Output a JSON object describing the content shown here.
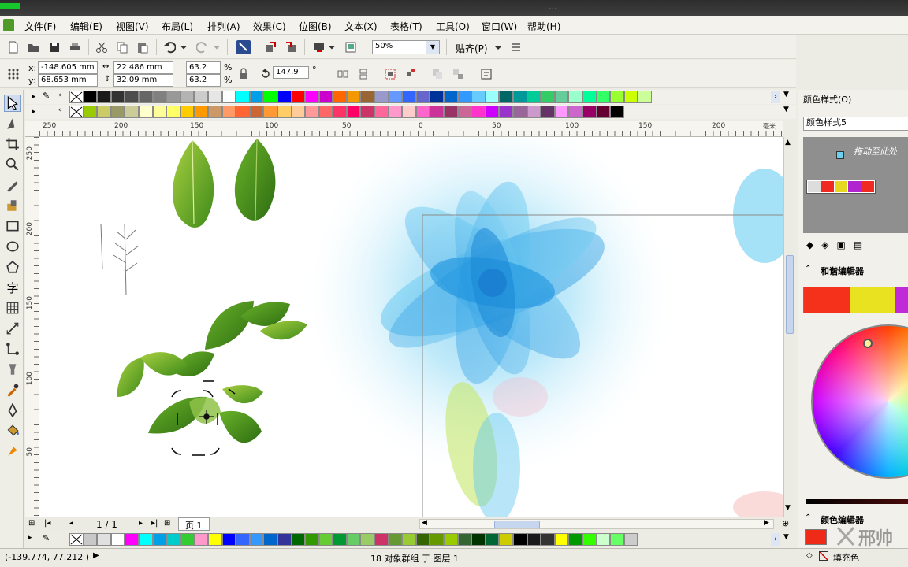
{
  "window": {
    "title": "..."
  },
  "menu": [
    "文件(F)",
    "编辑(E)",
    "视图(V)",
    "布局(L)",
    "排列(A)",
    "效果(C)",
    "位图(B)",
    "文本(X)",
    "表格(T)",
    "工具(O)",
    "窗口(W)",
    "帮助(H)"
  ],
  "toolbar": {
    "zoom": "50%",
    "snap": "贴齐(P)"
  },
  "property_bar": {
    "x": "-148.605 mm",
    "y": "68.653 mm",
    "x_label": "x:",
    "y_label": "y:",
    "width": "22.486 mm",
    "height": "32.09 mm",
    "scale_x": "63.2",
    "scale_y": "63.2",
    "pct1": "%",
    "pct2": "%",
    "rotation": "147.9",
    "deg": "°"
  },
  "rulers": {
    "h": [
      "250",
      "200",
      "150",
      "100",
      "50",
      "0",
      "50",
      "100",
      "150",
      "200"
    ],
    "v": [
      "250",
      "200",
      "150",
      "100",
      "50"
    ],
    "unit": "毫米"
  },
  "page_nav": {
    "count": "1 / 1",
    "tab": "页 1"
  },
  "status": {
    "coords": "(-139.774, 77.212 )",
    "selection": "18 对象群组 于 图层 1"
  },
  "docker": {
    "title": "颜色样式(O)",
    "style_name": "颜色样式5",
    "drop_hint": "拖动至此处",
    "harmony_editor": "和谐编辑器",
    "color_editor": "颜色编辑器",
    "fill_label": "填充色"
  },
  "watermark": {
    "text": "邢帅"
  },
  "colors": {
    "accent": "#316ac5",
    "harmony": [
      "#f5311b",
      "#e8e220",
      "#c02ad8"
    ],
    "color_editor_fill": "#ef2a16"
  },
  "palette_top": [
    "#000000",
    "#1a1a1a",
    "#333333",
    "#4d4d4d",
    "#666666",
    "#808080",
    "#999999",
    "#b3b3b3",
    "#cccccc",
    "#e6e6e6",
    "#ffffff",
    "#00ffff",
    "#00a0e9",
    "#00ff00",
    "#0000ff",
    "#ff0000",
    "#ff00ff",
    "#cc00cc",
    "#ff6600",
    "#f39800",
    "#996633",
    "#9999cc",
    "#6699ff",
    "#3366ff",
    "#6666cc",
    "#003399",
    "#0066cc",
    "#3399ff",
    "#66ccff",
    "#99ffff",
    "#006666",
    "#009999",
    "#00cc99",
    "#33cc66",
    "#66cc99",
    "#99ffcc",
    "#00ff99",
    "#33ff66",
    "#99ff33",
    "#ccff00",
    "#ccff99"
  ],
  "palette_mid": [
    "#99cc00",
    "#cccc66",
    "#999966",
    "#cccc99",
    "#ffffcc",
    "#ffff99",
    "#ffff66",
    "#ffcc00",
    "#ff9900",
    "#cc9966",
    "#ff9966",
    "#ff6633",
    "#cc6633",
    "#ff9933",
    "#ffcc66",
    "#ffcc99",
    "#ff9999",
    "#ff6666",
    "#ff3366",
    "#ff0066",
    "#cc3366",
    "#ff6699",
    "#ff99cc",
    "#ffcccc",
    "#ff66cc",
    "#cc3399",
    "#993366",
    "#cc6699",
    "#ff33cc",
    "#cc00ff",
    "#9933cc",
    "#996699",
    "#cc99cc",
    "#663366",
    "#ff99ff",
    "#cc66cc",
    "#990066",
    "#660033",
    "#000000"
  ],
  "palette_bottom": [
    "#c8c8c8",
    "#e0e0e0",
    "#ffffff",
    "#ff00ff",
    "#00ffff",
    "#00a0e9",
    "#00cccc",
    "#33cc33",
    "#ff99cc",
    "#ffff00",
    "#0000ff",
    "#3366ff",
    "#3399ff",
    "#0066cc",
    "#333399",
    "#006600",
    "#339900",
    "#66cc33",
    "#009933",
    "#66cc66",
    "#99cc66",
    "#cc3366",
    "#669933",
    "#99cc33",
    "#336600",
    "#669900",
    "#99cc00",
    "#336633",
    "#003300",
    "#006633",
    "#cccc00",
    "#000000",
    "#1a1a1a",
    "#333333",
    "#ffff00",
    "#009900",
    "#33ff00",
    "#ccffcc",
    "#66ff66",
    "#cccccc"
  ]
}
